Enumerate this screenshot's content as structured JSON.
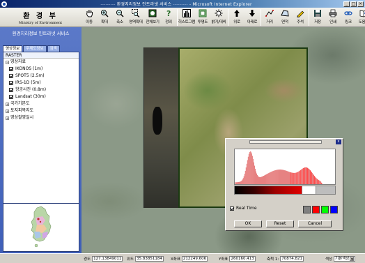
{
  "window": {
    "title": "환경지리정보 인트라넷 서비스",
    "title_dashes": "---------",
    "browser": "- Microsoft Internet Explorer"
  },
  "logo": {
    "korean": "환 경 부",
    "english": "Ministry of Environment"
  },
  "toolbar": {
    "buttons": [
      {
        "label": "이동",
        "icon": "hand-icon"
      },
      {
        "label": "확대",
        "icon": "zoom-in-icon"
      },
      {
        "label": "축소",
        "icon": "zoom-out-icon"
      },
      {
        "label": "영역확대",
        "icon": "zoom-area-icon"
      },
      {
        "label": "전체보기",
        "icon": "full-extent-icon"
      },
      {
        "label": "정의",
        "icon": "help-icon"
      },
      {
        "label": "히스토그램",
        "icon": "histogram-icon"
      },
      {
        "label": "투명도",
        "icon": "transparency-icon"
      },
      {
        "label": "밝기/대비",
        "icon": "brightness-icon"
      },
      {
        "label": "위로",
        "icon": "up-arrow-icon"
      },
      {
        "label": "아래로",
        "icon": "down-arrow-icon"
      },
      {
        "label": "거리",
        "icon": "distance-icon"
      },
      {
        "label": "면적",
        "icon": "area-icon"
      },
      {
        "label": "주석",
        "icon": "annotation-icon"
      },
      {
        "label": "저장",
        "icon": "save-icon"
      },
      {
        "label": "인쇄",
        "icon": "print-icon"
      },
      {
        "label": "링크",
        "icon": "link-icon"
      },
      {
        "label": "도움말",
        "icon": "help-book-icon"
      }
    ]
  },
  "sidebar": {
    "service_title": "환경지리정보 인트라넷 서비스",
    "tabs": [
      {
        "label": "영상정보",
        "active": true
      },
      {
        "label": "주제도정보",
        "active": false
      },
      {
        "label": "검색",
        "active": false
      }
    ],
    "layer_header": "RASTER",
    "layer_tree": [
      {
        "type": "group",
        "label": "영상자료",
        "expander": "⊟"
      },
      {
        "type": "item",
        "label": "IKONOS (1m)",
        "checked": true
      },
      {
        "type": "item",
        "label": "SPOT5 (2.5m)",
        "checked": true
      },
      {
        "type": "item",
        "label": "IRS-1D (5m)",
        "checked": true
      },
      {
        "type": "item",
        "label": "항공사진 (0.8m)",
        "checked": true
      },
      {
        "type": "item",
        "label": "Landsat (30m)",
        "checked": true
      },
      {
        "type": "group",
        "label": "국가기본도",
        "expander": "⊞"
      },
      {
        "type": "group",
        "label": "토지피복지도",
        "expander": "⊞"
      },
      {
        "type": "group",
        "label": "영상촬영일시",
        "expander": "⊞"
      }
    ]
  },
  "histogram_dialog": {
    "close_label": "x",
    "realtime_label": "Real Time",
    "realtime_checked": true,
    "ok_label": "OK",
    "reset_label": "Reset",
    "cancel_label": "Cancel",
    "swatches": [
      "#808080",
      "#ff0000",
      "#00ff00",
      "#0000ff"
    ]
  },
  "status": {
    "longitude_label": "경도",
    "longitude_value": "127.13849011",
    "latitude_label": "위도",
    "latitude_value": "35.83851184",
    "x_label": "X좌표",
    "x_value": "212249.606",
    "y_label": "Y좌표",
    "y_value": "260160.413",
    "scale_label": "축척 1:",
    "scale_value": "70874.821",
    "color_label": "색상",
    "color_value": "기본색상"
  }
}
